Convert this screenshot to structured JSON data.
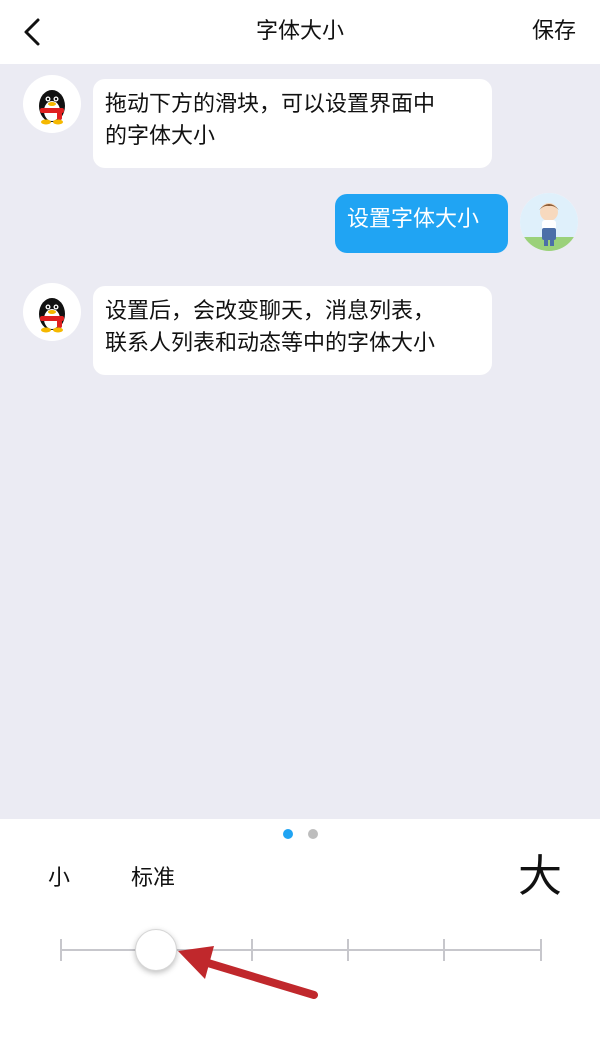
{
  "nav": {
    "title": "字体大小",
    "save_label": "保存"
  },
  "chat": {
    "messages": [
      {
        "from": "bot",
        "text_lines": [
          "拖动下方的滑块，可以设置界面中",
          "的字体大小"
        ]
      },
      {
        "from": "me",
        "text": "设置字体大小"
      },
      {
        "from": "bot",
        "text_lines": [
          "设置后，会改变聊天，消息列表，",
          "联系人列表和动态等中的字体大小"
        ]
      }
    ]
  },
  "font_size": {
    "label_small": "小",
    "label_standard": "标准",
    "label_large": "大",
    "steps": 6,
    "selected_index": 1
  },
  "pager": {
    "pages": 2,
    "current": 1
  },
  "colors": {
    "accent": "#20a4f3",
    "chat_bg": "#ebebf3",
    "arrow": "#c0282c",
    "dot_inactive": "#bdbdbd"
  },
  "icons": [
    "back-icon",
    "qq-penguin-avatar-icon",
    "user-avatar-icon"
  ]
}
